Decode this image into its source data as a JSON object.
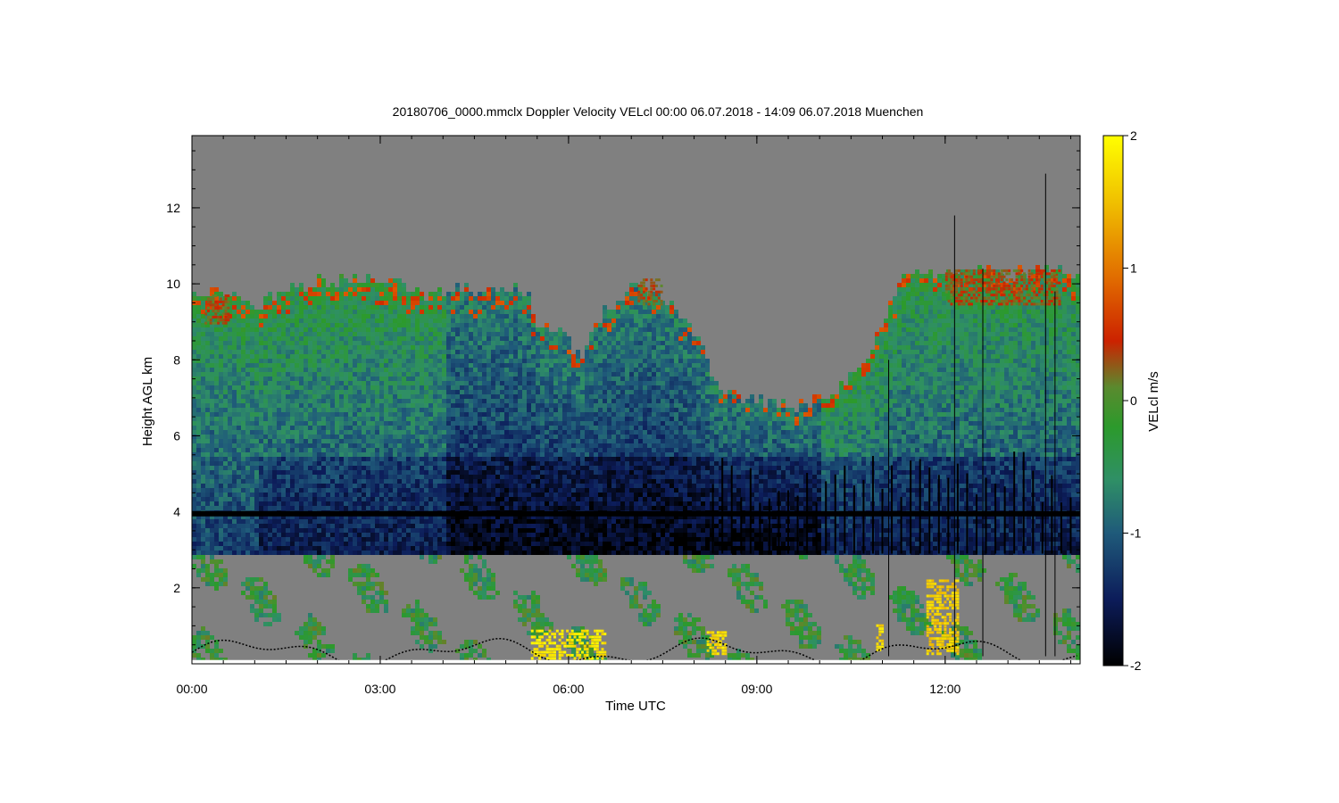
{
  "chart_data": {
    "type": "heatmap",
    "title": "20180706_0000.mmclx Doppler Velocity VELcl   00:00 06.07.2018 - 14:09 06.07.2018 Muenchen",
    "xlabel": "Time UTC",
    "ylabel": "Height AGL km",
    "x_range_hours": [
      0,
      14.15
    ],
    "y_range_km": [
      0,
      13.9
    ],
    "x_ticks": [
      {
        "hour": 0,
        "label": "00:00"
      },
      {
        "hour": 3,
        "label": "03:00"
      },
      {
        "hour": 6,
        "label": "06:00"
      },
      {
        "hour": 9,
        "label": "09:00"
      },
      {
        "hour": 12,
        "label": "12:00"
      }
    ],
    "y_ticks": [
      {
        "km": 2,
        "label": "2"
      },
      {
        "km": 4,
        "label": "4"
      },
      {
        "km": 6,
        "label": "6"
      },
      {
        "km": 8,
        "label": "8"
      },
      {
        "km": 10,
        "label": "10"
      },
      {
        "km": 12,
        "label": "12"
      }
    ],
    "colorbar": {
      "label": "VELcl m/s",
      "range": [
        -2,
        2
      ],
      "ticks": [
        {
          "value": 2,
          "label": "2"
        },
        {
          "value": 1,
          "label": "1"
        },
        {
          "value": 0,
          "label": "0"
        },
        {
          "value": -1,
          "label": "-1"
        },
        {
          "value": -2,
          "label": "-2"
        }
      ],
      "stops": [
        {
          "value": -2,
          "color": "#000000"
        },
        {
          "value": -1.5,
          "color": "#0c1c5a"
        },
        {
          "value": -1.0,
          "color": "#1f5a7a"
        },
        {
          "value": -0.6,
          "color": "#2f8f66"
        },
        {
          "value": -0.2,
          "color": "#2c9a2c"
        },
        {
          "value": 0.1,
          "color": "#5a8a2e"
        },
        {
          "value": 0.45,
          "color": "#cc2200"
        },
        {
          "value": 0.9,
          "color": "#e06800"
        },
        {
          "value": 1.5,
          "color": "#f0c000"
        },
        {
          "value": 2.0,
          "color": "#ffff00"
        }
      ]
    },
    "no_data_color": "#808080",
    "cloud_regions": [
      {
        "name": "main-cloud-layer",
        "start_h": 0.0,
        "end_h": 14.15,
        "base_km": 2.9,
        "top_km_profile": [
          [
            0.0,
            9.8
          ],
          [
            0.3,
            9.8
          ],
          [
            0.8,
            9.7
          ],
          [
            1.0,
            9.4
          ],
          [
            1.4,
            10.0
          ],
          [
            2.0,
            10.1
          ],
          [
            2.8,
            10.2
          ],
          [
            3.2,
            10.1
          ],
          [
            3.5,
            9.7
          ],
          [
            4.2,
            9.9
          ],
          [
            5.3,
            9.9
          ],
          [
            5.5,
            9.0
          ],
          [
            5.8,
            8.8
          ],
          [
            6.2,
            8.2
          ],
          [
            6.5,
            9.3
          ],
          [
            7.1,
            10.1
          ],
          [
            7.6,
            9.5
          ],
          [
            8.0,
            8.8
          ],
          [
            8.3,
            7.4
          ],
          [
            8.9,
            7.0
          ],
          [
            9.5,
            6.8
          ],
          [
            10.2,
            7.2
          ],
          [
            10.8,
            8.4
          ],
          [
            11.3,
            10.3
          ],
          [
            11.8,
            10.4
          ],
          [
            12.5,
            10.5
          ],
          [
            13.0,
            10.3
          ],
          [
            13.5,
            10.4
          ],
          [
            14.15,
            10.4
          ]
        ]
      },
      {
        "name": "low-boundary-layer-echoes",
        "start_h": 0.0,
        "end_h": 14.15,
        "base_km": 0.1,
        "top_km": 2.9
      }
    ],
    "melting_layer_km": 3.95,
    "updraft_spikes_h": [
      8.3,
      8.45,
      8.6,
      8.75,
      8.9,
      9.05,
      9.2,
      9.35,
      9.5,
      9.65,
      9.8,
      9.95,
      10.1,
      10.25,
      10.4,
      10.55,
      10.7,
      10.85,
      11.0,
      11.15,
      11.3,
      11.45,
      11.6,
      11.75,
      11.9,
      12.05,
      12.2,
      12.35,
      12.5,
      12.65,
      12.8,
      12.95,
      13.1,
      13.25,
      13.4,
      13.55,
      13.7,
      13.85,
      14.0
    ],
    "tall_spikes": [
      {
        "hour": 12.15,
        "top_km": 11.8
      },
      {
        "hour": 13.6,
        "top_km": 12.9
      },
      {
        "hour": 13.75,
        "top_km": 9.8
      },
      {
        "hour": 12.6,
        "top_km": 10.4
      },
      {
        "hour": 11.1,
        "top_km": 8.0
      }
    ],
    "positive_velocity_patches": [
      {
        "start_h": 5.4,
        "end_h": 6.6,
        "base_km": 0.1,
        "top_km": 0.9,
        "value": 2.0
      },
      {
        "start_h": 8.2,
        "end_h": 8.5,
        "base_km": 0.3,
        "top_km": 0.9,
        "value": 1.9
      },
      {
        "start_h": 11.7,
        "end_h": 12.2,
        "base_km": 0.3,
        "top_km": 2.3,
        "value": 1.8
      },
      {
        "start_h": 10.9,
        "end_h": 11.0,
        "base_km": 0.4,
        "top_km": 1.1,
        "value": 1.9
      },
      {
        "start_h": 12.0,
        "end_h": 13.8,
        "base_km": 9.5,
        "top_km": 10.4,
        "value": 0.5
      },
      {
        "start_h": 0.2,
        "end_h": 0.6,
        "base_km": 9.0,
        "top_km": 9.8,
        "value": 0.5
      },
      {
        "start_h": 7.1,
        "end_h": 7.5,
        "base_km": 9.5,
        "top_km": 10.2,
        "value": 0.5
      }
    ]
  }
}
